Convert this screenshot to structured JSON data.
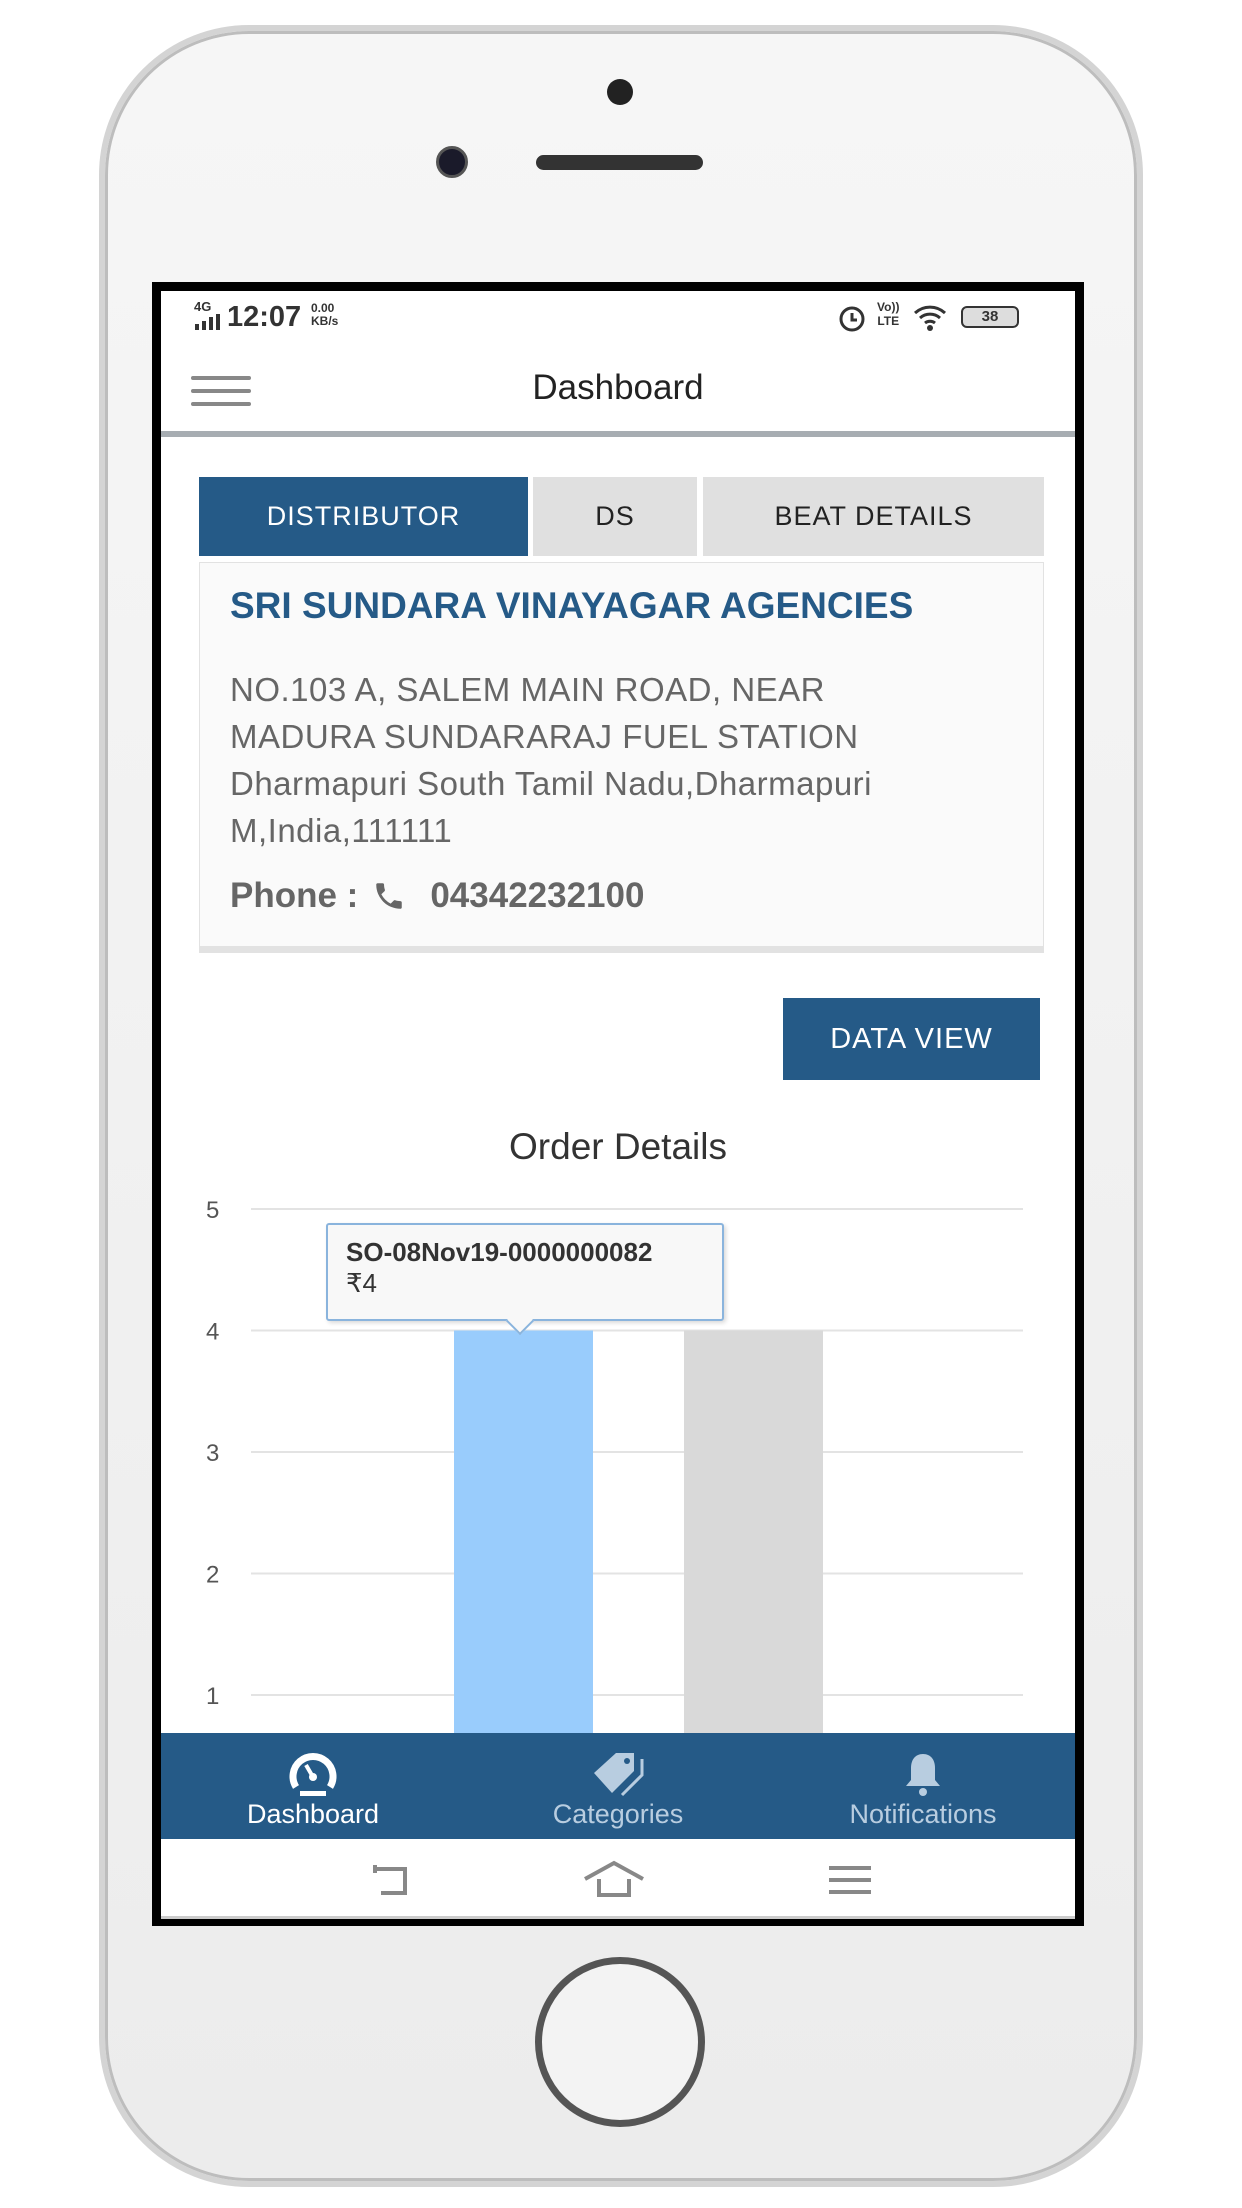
{
  "status_bar": {
    "network": "4G",
    "time": "12:07",
    "speed_value": "0.00",
    "speed_unit": "KB/s",
    "volte": "Vo))",
    "lte": "LTE",
    "battery": "38"
  },
  "header": {
    "title": "Dashboard"
  },
  "tabs": [
    {
      "label": "DISTRIBUTOR",
      "active": true
    },
    {
      "label": "DS",
      "active": false
    },
    {
      "label": "BEAT DETAILS",
      "active": false
    }
  ],
  "distributor": {
    "name": "SRI SUNDARA VINAYAGAR AGENCIES",
    "address_lines": [
      "NO.103 A, SALEM MAIN ROAD, NEAR",
      "MADURA SUNDARARAJ FUEL STATION",
      "Dharmapuri South Tamil Nadu,Dharmapuri",
      "M,India,111111"
    ],
    "phone_label": "Phone :",
    "phone": "04342232100"
  },
  "data_view_label": "DATA  VIEW",
  "chart_data": {
    "type": "bar",
    "title": "Order Details",
    "yticks": [
      "1",
      "2",
      "3",
      "4",
      "5"
    ],
    "ylim": [
      0,
      5
    ],
    "grid": true,
    "series": [
      {
        "values": [
          4,
          4
        ]
      }
    ],
    "colors": [
      "#99ccfc",
      "#d9d9d9"
    ],
    "tooltip": {
      "label": "SO-08Nov19-0000000082",
      "value": "₹4"
    }
  },
  "bottom_nav": [
    {
      "label": "Dashboard",
      "icon": "speedometer-icon",
      "active": true
    },
    {
      "label": "Categories",
      "icon": "tags-icon",
      "active": false
    },
    {
      "label": "Notifications",
      "icon": "bell-icon",
      "active": false
    }
  ],
  "colors": {
    "primary": "#255a87",
    "tab_inactive": "#e0e0e0"
  }
}
